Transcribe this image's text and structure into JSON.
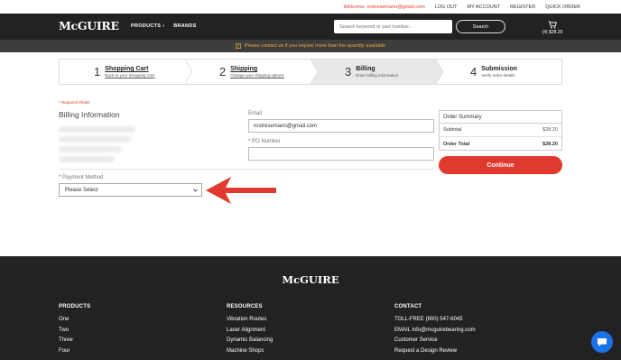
{
  "topbar": {
    "welcome": "Welcome, nrstresemann@gmail.com",
    "logout": "LOG OUT",
    "account": "MY ACCOUNT",
    "register": "REGISTER",
    "quick_order": "QUICK ORDER"
  },
  "header": {
    "logo": "McGUIRE",
    "nav_products": "PRODUCTS",
    "nav_brands": "BRANDS",
    "search_placeholder": "Search keyword or part number...",
    "search_button": "Search",
    "cart_summary": "(4) $28.20"
  },
  "banner": {
    "text": "Please contact us if you require more than the quantity available",
    "accent": "#f2a63b"
  },
  "steps": [
    {
      "num": "1",
      "title": "Shopping Cart",
      "sub": "Back to your Shopping Cart"
    },
    {
      "num": "2",
      "title": "Shipping",
      "sub": "Change your shipping options"
    },
    {
      "num": "3",
      "title": "Billing",
      "sub": "Enter billing information"
    },
    {
      "num": "4",
      "title": "Submission",
      "sub": "Verify order details"
    }
  ],
  "form": {
    "required_note": "* Required Fields",
    "billing_title": "Billing Information",
    "email_label": "Email",
    "email_value": "nrstresemann@gmail.com",
    "po_label": "PO Number",
    "payment_label": "Payment Method",
    "payment_selected": "Please Select"
  },
  "summary": {
    "title": "Order Summary",
    "subtotal_label": "Subtotal",
    "subtotal_value": "$28.20",
    "total_label": "Order Total",
    "total_value": "$28.20",
    "continue": "Continue"
  },
  "footer": {
    "logo": "McGUIRE",
    "products": {
      "heading": "PRODUCTS",
      "items": [
        "One",
        "Two",
        "Three",
        "Four"
      ]
    },
    "resources": {
      "heading": "RESOURCES",
      "items": [
        "Vibration Routes",
        "Laser Alignment",
        "Dynamic Balancing",
        "Machine Shops"
      ]
    },
    "contact": {
      "heading": "CONTACT",
      "items": [
        "TOLL-FREE (800) 547-6045",
        "EMAIL info@mcguirebearing.com",
        "Customer Service",
        "Request a Design Review"
      ]
    }
  },
  "colors": {
    "brand_red": "#e03a2f",
    "dark": "#222222",
    "chat_blue": "#1a73e8"
  }
}
